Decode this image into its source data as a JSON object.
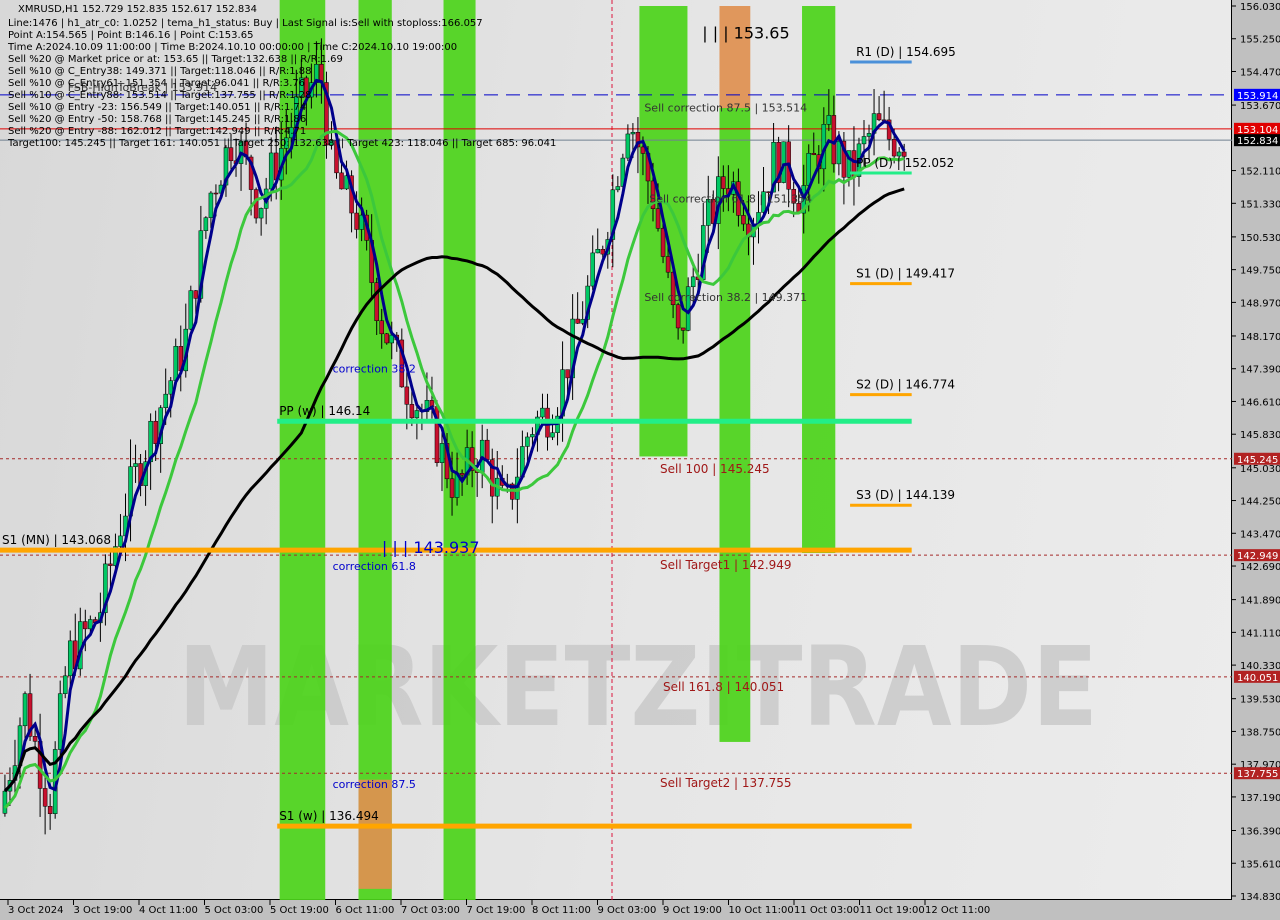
{
  "header": {
    "symbol_line": "XMRUSD,H1  152.729 152.835 152.617 152.834",
    "info_lines": [
      "Line:1476 | h1_atr_c0: 1.0252 | tema_h1_status: Buy | Last Signal is:Sell with stoploss:166.057",
      "Point A:154.565 | Point B:146.16 | Point C:153.65",
      "Time A:2024.10.09 11:00:00 | Time B:2024.10.10 00:00:00 | Time C:2024.10.10 19:00:00",
      "Sell %20 @ Market price or at: 153.65 || Target:132.638 || R/R:1.69",
      "Sell %10 @ C_Entry38: 149.371 || Target:118.046 || R/R:1.88",
      "Sell %10 @ C_Entry61: 151.354 || Target:96.041 || R/R:3.76",
      "Sell %10 @ C_Entry88: 153.514 || Target:137.755 || R/R:1.28",
      "Sell %10 @ Entry -23: 156.549 || Target:140.051 || R/R:1.74",
      "Sell %20 @ Entry -50: 158.768 || Target:145.245 || R/R:1.86",
      "Sell %20 @ Entry -88: 162.012 || Target:142.949 || R/R:4.71",
      "Target100: 145.245 || Target 161: 140.051 || Target 250: 132.638 || Target 423: 118.046 || Target 685: 96.041"
    ]
  },
  "colors": {
    "bull": "#00c864",
    "bear": "#c8102e",
    "green_zone": "#4cd41a",
    "orange_zone": "#e09050",
    "blue_dash": "#0000c8",
    "red_line": "#e00000",
    "orange_level": "#ffa500",
    "aqua_level": "#22ee88",
    "dark_red_dash": "#a52a2a",
    "tema": "#00008b",
    "ma_green": "#3cc83c",
    "ma_black": "#000000"
  },
  "chart_data": {
    "type": "candlestick",
    "title": "XMRUSD,H1",
    "ylim": [
      134.83,
      156.03
    ],
    "y_ticks": [
      156.03,
      155.25,
      154.47,
      153.67,
      152.11,
      151.33,
      150.53,
      149.75,
      148.97,
      148.17,
      147.39,
      146.61,
      145.83,
      145.03,
      144.25,
      143.47,
      142.69,
      141.89,
      141.11,
      140.33,
      139.53,
      138.75,
      137.97,
      137.19,
      136.39,
      135.61,
      134.83
    ],
    "x_ticks": [
      "3 Oct 2024",
      "3 Oct 19:00",
      "4 Oct 11:00",
      "5 Oct 03:00",
      "5 Oct 19:00",
      "6 Oct 11:00",
      "7 Oct 03:00",
      "7 Oct 19:00",
      "8 Oct 11:00",
      "9 Oct 03:00",
      "9 Oct 19:00",
      "10 Oct 11:00",
      "11 Oct 03:00",
      "11 Oct 19:00",
      "12 Oct 11:00"
    ],
    "price_tags": [
      {
        "value": 153.914,
        "label": "153.914",
        "bg": "#0000ff",
        "fg": "#ffffff"
      },
      {
        "value": 153.104,
        "label": "153.104",
        "bg": "#e00000",
        "fg": "#ffffff"
      },
      {
        "value": 152.834,
        "label": "152.834",
        "bg": "#000000",
        "fg": "#ffffff"
      },
      {
        "value": 145.245,
        "label": "145.245",
        "bg": "#b22222",
        "fg": "#ffffff"
      },
      {
        "value": 142.949,
        "label": "142.949",
        "bg": "#b22222",
        "fg": "#ffffff"
      },
      {
        "value": 140.051,
        "label": "140.051",
        "bg": "#b22222",
        "fg": "#ffffff"
      },
      {
        "value": 137.755,
        "label": "137.755",
        "bg": "#b22222",
        "fg": "#ffffff"
      }
    ],
    "levels": [
      {
        "name": "R1 (D)",
        "value": 154.695,
        "label": "R1 (D) | 154.695",
        "color": "#4a90d9",
        "from": 0.69,
        "to": 0.74
      },
      {
        "name": "PP (D)",
        "value": 152.052,
        "label": "PP (D) | 152.052",
        "color": "#22ee88",
        "from": 0.69,
        "to": 0.74
      },
      {
        "name": "S1 (D)",
        "value": 149.417,
        "label": "S1 (D) | 149.417",
        "color": "#ffa500",
        "from": 0.69,
        "to": 0.74
      },
      {
        "name": "S2 (D)",
        "value": 146.774,
        "label": "S2 (D) | 146.774",
        "color": "#ffa500",
        "from": 0.69,
        "to": 0.74
      },
      {
        "name": "S3 (D)",
        "value": 144.139,
        "label": "S3 (D) | 144.139",
        "color": "#ffa500",
        "from": 0.69,
        "to": 0.74
      },
      {
        "name": "PP (w)",
        "value": 146.14,
        "label": "PP (w) | 146.14",
        "color": "#22ee88",
        "from": 0.225,
        "to": 0.74
      },
      {
        "name": "S1 (w)",
        "value": 136.494,
        "label": "S1 (w) | 136.494",
        "color": "#ffa500",
        "from": 0.225,
        "to": 0.74
      },
      {
        "name": "S1 (MN)",
        "value": 143.068,
        "label": "S1 (MN) | 143.068",
        "color": "#ffa500",
        "from": 0.0,
        "to": 0.74
      }
    ],
    "dashed_levels": [
      {
        "value": 145.245,
        "label": "Sell 100 | 145.245"
      },
      {
        "value": 142.949,
        "label": "Sell Target1 | 142.949"
      },
      {
        "value": 140.051,
        "label": "Sell 161.8 | 140.051"
      },
      {
        "value": 137.755,
        "label": "Sell Target2 | 137.755"
      }
    ],
    "annotations": [
      {
        "text": "| | | 153.65",
        "value": 155.25,
        "x": 0.57,
        "color": "#000000",
        "size": "big"
      },
      {
        "text": "Sell correction 87.5 | 153.514",
        "value": 153.514,
        "x": 0.523,
        "color": "#333333"
      },
      {
        "text": "Sell correction 61.8 | 151.354",
        "value": 151.354,
        "x": 0.527,
        "color": "#333333"
      },
      {
        "text": "Sell correction 38.2 | 149.371",
        "value": 149.0,
        "x": 0.523,
        "color": "#333333"
      },
      {
        "text": "correction 38.2",
        "value": 147.3,
        "x": 0.27,
        "color": "#0000cc"
      },
      {
        "text": "correction 61.8",
        "value": 142.6,
        "x": 0.27,
        "color": "#0000cc"
      },
      {
        "text": "correction 87.5",
        "value": 137.4,
        "x": 0.27,
        "color": "#0000cc"
      },
      {
        "text": "| | | 143.937",
        "value": 143.0,
        "x": 0.31,
        "color": "#0000cc",
        "size": "big"
      },
      {
        "text": "FSB-HighToBreak | 153.914",
        "value": 154.0,
        "x": 0.055,
        "color": "#333333"
      }
    ],
    "hlines": [
      {
        "value": 153.914,
        "style": "dash-blue"
      },
      {
        "value": 153.104,
        "style": "solid-red"
      },
      {
        "value": 152.834,
        "style": "solid-gray"
      }
    ],
    "zones": [
      {
        "from": 0.227,
        "to": 0.264,
        "color": "green"
      },
      {
        "from": 0.291,
        "to": 0.318,
        "color": "green"
      },
      {
        "from": 0.291,
        "to": 0.318,
        "color": "orange",
        "yfrom": 135.0,
        "yto": 137.6
      },
      {
        "from": 0.36,
        "to": 0.386,
        "color": "green"
      },
      {
        "from": 0.519,
        "to": 0.558,
        "color": "green",
        "yfrom": 145.3,
        "yto": 156.03
      },
      {
        "from": 0.584,
        "to": 0.609,
        "color": "orange",
        "yfrom": 153.6,
        "yto": 156.03
      },
      {
        "from": 0.584,
        "to": 0.609,
        "color": "green",
        "yfrom": 138.5,
        "yto": 153.6
      },
      {
        "from": 0.651,
        "to": 0.678,
        "color": "green",
        "yfrom": 143.0,
        "yto": 156.03
      }
    ],
    "watermark": "MARKETZITRADE",
    "close": 152.834,
    "series_summary": {
      "open_first": 136.8,
      "low_point": 135.3,
      "high_point": 154.8,
      "last": 152.834
    }
  }
}
